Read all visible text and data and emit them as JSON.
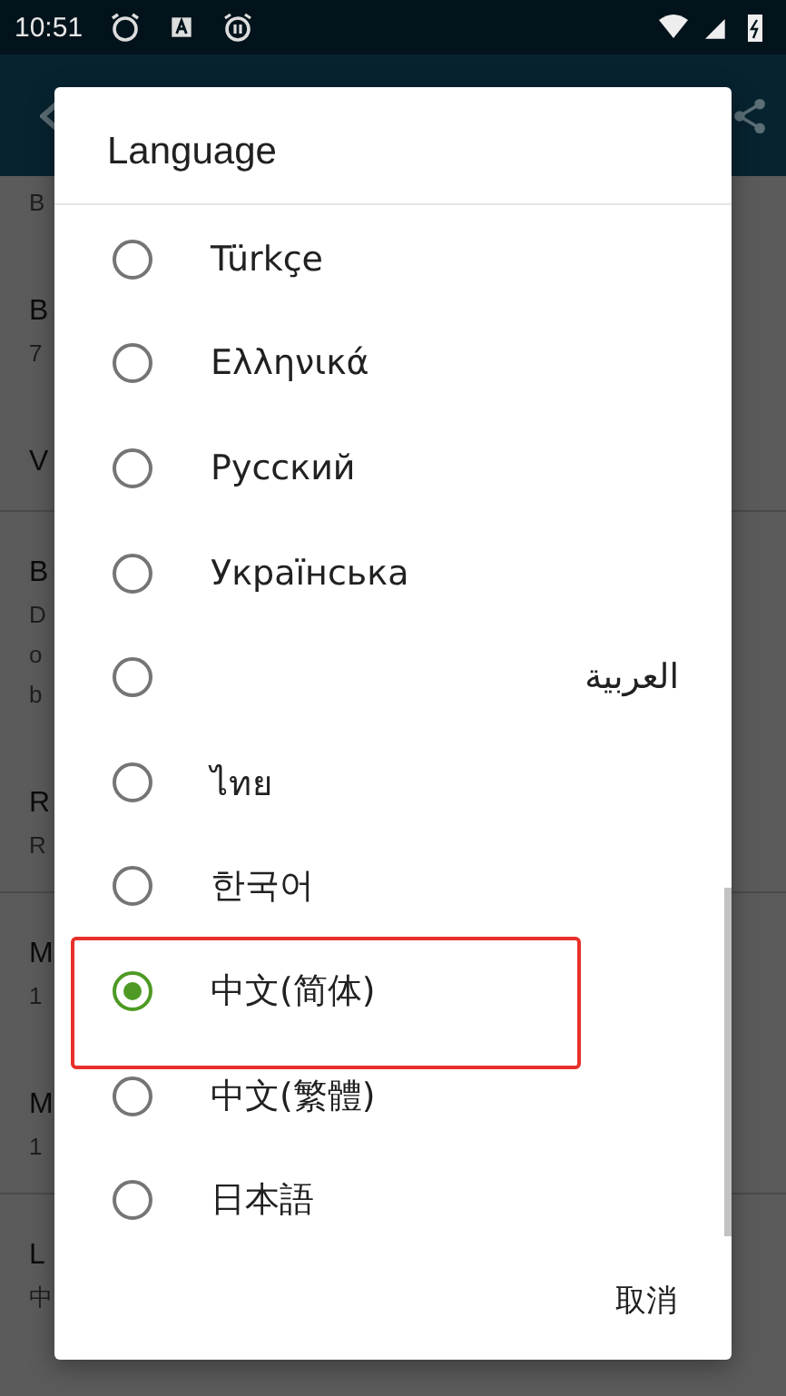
{
  "status_bar": {
    "time": "10:51"
  },
  "settings": [
    {
      "subtitle": [
        "B"
      ],
      "divider": false
    },
    {
      "title": "B",
      "subtitle": [
        "7"
      ],
      "divider": false
    },
    {
      "title": "V",
      "divider": true
    },
    {
      "title": "B",
      "subtitle": [
        "D",
        "o",
        "b"
      ],
      "divider": false
    },
    {
      "title": "R",
      "subtitle": [
        "R"
      ],
      "divider": true
    },
    {
      "title": "M",
      "subtitle": [
        "1"
      ],
      "divider": false
    },
    {
      "title": "M",
      "subtitle": [
        "1"
      ],
      "divider": true
    },
    {
      "title": "L",
      "subtitle": [
        "中"
      ],
      "divider": false
    }
  ],
  "dialog": {
    "title": "Language",
    "options": [
      {
        "label": "Türkçe",
        "selected": false,
        "highlighted": false
      },
      {
        "label": "Ελληνικά",
        "selected": false,
        "highlighted": false
      },
      {
        "label": "Русский",
        "selected": false,
        "highlighted": false
      },
      {
        "label": "Українська",
        "selected": false,
        "highlighted": false
      },
      {
        "label": "العربية",
        "selected": false,
        "highlighted": false,
        "rtl": true
      },
      {
        "label": "ไทย",
        "selected": false,
        "highlighted": false
      },
      {
        "label": "한국어",
        "selected": false,
        "highlighted": false
      },
      {
        "label": "中文(简体)",
        "selected": true,
        "highlighted": true
      },
      {
        "label": "中文(繁體)",
        "selected": false,
        "highlighted": false
      },
      {
        "label": "日本語",
        "selected": false,
        "highlighted": false
      }
    ],
    "cancel": "取消"
  }
}
